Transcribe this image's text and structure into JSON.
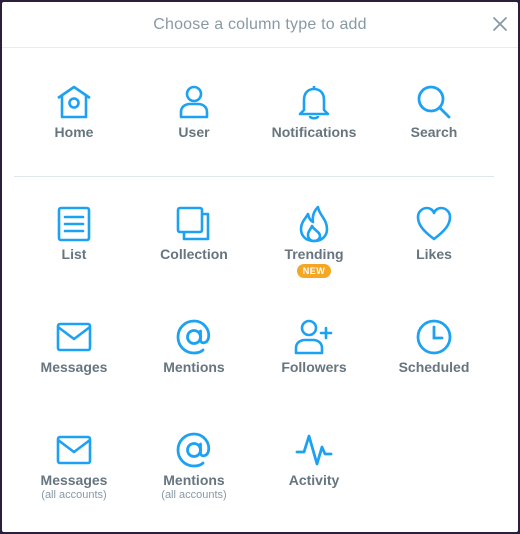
{
  "header": {
    "title": "Choose a column type to add"
  },
  "accent": "#1da1f2",
  "rows": [
    [
      {
        "label": "Home",
        "icon": "home-icon"
      },
      {
        "label": "User",
        "icon": "user-icon"
      },
      {
        "label": "Notifications",
        "icon": "bell-icon"
      },
      {
        "label": "Search",
        "icon": "search-icon"
      }
    ],
    [
      {
        "label": "List",
        "icon": "list-icon"
      },
      {
        "label": "Collection",
        "icon": "collection-icon"
      },
      {
        "label": "Trending",
        "icon": "flame-icon",
        "badge": "NEW"
      },
      {
        "label": "Likes",
        "icon": "heart-icon"
      }
    ],
    [
      {
        "label": "Messages",
        "icon": "envelope-icon"
      },
      {
        "label": "Mentions",
        "icon": "at-icon"
      },
      {
        "label": "Followers",
        "icon": "add-user-icon"
      },
      {
        "label": "Scheduled",
        "icon": "clock-icon"
      }
    ],
    [
      {
        "label": "Messages",
        "icon": "envelope-icon",
        "sub": "(all accounts)"
      },
      {
        "label": "Mentions",
        "icon": "at-icon",
        "sub": "(all accounts)"
      },
      {
        "label": "Activity",
        "icon": "activity-icon"
      }
    ]
  ]
}
